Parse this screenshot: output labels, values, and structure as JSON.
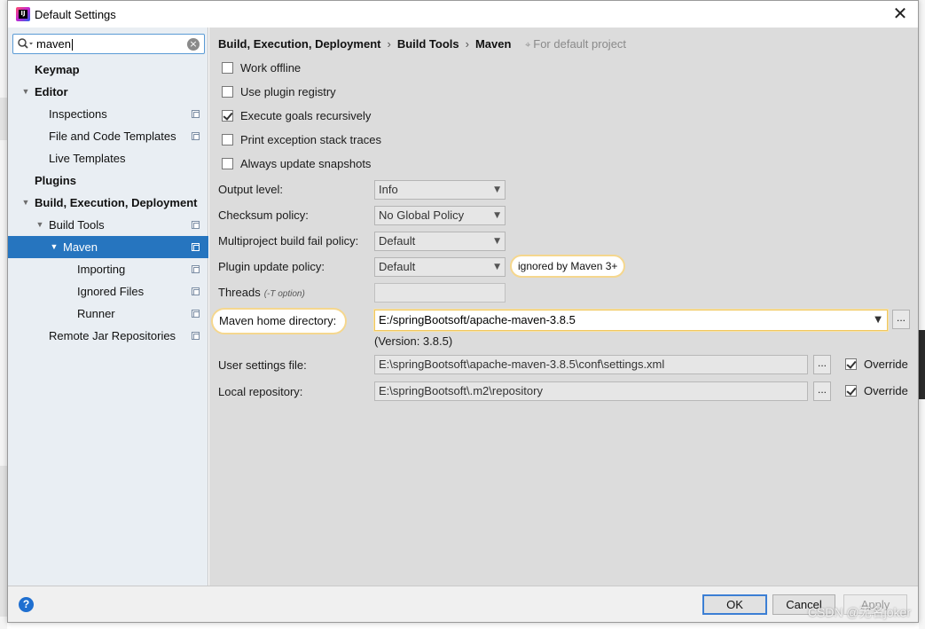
{
  "window": {
    "title": "Default Settings",
    "close_label": "✕"
  },
  "search": {
    "query": "maven",
    "clear_label": "×"
  },
  "tree": [
    {
      "label": "Keymap",
      "level": 1,
      "bold": true,
      "arrow": "",
      "proj": false,
      "selected": false
    },
    {
      "label": "Editor",
      "level": 1,
      "bold": true,
      "arrow": "▼",
      "proj": false,
      "selected": false
    },
    {
      "label": "Inspections",
      "level": 2,
      "bold": false,
      "arrow": "",
      "proj": true,
      "selected": false
    },
    {
      "label": "File and Code Templates",
      "level": 2,
      "bold": false,
      "arrow": "",
      "proj": true,
      "selected": false
    },
    {
      "label": "Live Templates",
      "level": 2,
      "bold": false,
      "arrow": "",
      "proj": false,
      "selected": false
    },
    {
      "label": "Plugins",
      "level": 1,
      "bold": true,
      "arrow": "",
      "proj": false,
      "selected": false
    },
    {
      "label": "Build, Execution, Deployment",
      "level": 1,
      "bold": true,
      "arrow": "▼",
      "proj": false,
      "selected": false
    },
    {
      "label": "Build Tools",
      "level": 2,
      "bold": false,
      "arrow": "▼",
      "proj": true,
      "selected": false
    },
    {
      "label": "Maven",
      "level": 3,
      "bold": false,
      "arrow": "▼",
      "proj": true,
      "selected": true
    },
    {
      "label": "Importing",
      "level": 4,
      "bold": false,
      "arrow": "",
      "proj": true,
      "selected": false
    },
    {
      "label": "Ignored Files",
      "level": 4,
      "bold": false,
      "arrow": "",
      "proj": true,
      "selected": false
    },
    {
      "label": "Runner",
      "level": 4,
      "bold": false,
      "arrow": "",
      "proj": true,
      "selected": false
    },
    {
      "label": "Remote Jar Repositories",
      "level": 2,
      "bold": false,
      "arrow": "",
      "proj": true,
      "selected": false
    }
  ],
  "breadcrumb": {
    "items": [
      "Build, Execution, Deployment",
      "Build Tools",
      "Maven"
    ],
    "separator": "›",
    "project_icon": "⌖",
    "project_note": "For default project"
  },
  "checkboxes": [
    {
      "label": "Work offline",
      "checked": false
    },
    {
      "label": "Use plugin registry",
      "checked": false
    },
    {
      "label": "Execute goals recursively",
      "checked": true
    },
    {
      "label": "Print exception stack traces",
      "checked": false
    },
    {
      "label": "Always update snapshots",
      "checked": false
    }
  ],
  "fields": {
    "output_level": {
      "label": "Output level:",
      "value": "Info"
    },
    "checksum_policy": {
      "label": "Checksum policy:",
      "value": "No Global Policy"
    },
    "multiproject_fail": {
      "label": "Multiproject build fail policy:",
      "value": "Default"
    },
    "plugin_update": {
      "label": "Plugin update policy:",
      "value": "Default",
      "note": "ignored by Maven 3+"
    },
    "threads": {
      "label": "Threads",
      "hint": "(-T option)",
      "value": ""
    },
    "maven_home": {
      "label": "Maven home directory:",
      "value": "E:/springBootsoft/apache-maven-3.8.5",
      "version": "(Version: 3.8.5)"
    },
    "user_settings": {
      "label": "User settings file:",
      "value": "E:\\springBootsoft\\apache-maven-3.8.5\\conf\\settings.xml",
      "override_label": "Override",
      "override_checked": true
    },
    "local_repo": {
      "label": "Local repository:",
      "value": "E:\\springBootsoft\\.m2\\repository",
      "override_label": "Override",
      "override_checked": true
    }
  },
  "chevron": "▼",
  "browse_label": "...",
  "buttons": {
    "help": "?",
    "ok": "OK",
    "cancel": "Cancel",
    "apply": "Apply"
  },
  "watermark": "CSDN @无名joker"
}
